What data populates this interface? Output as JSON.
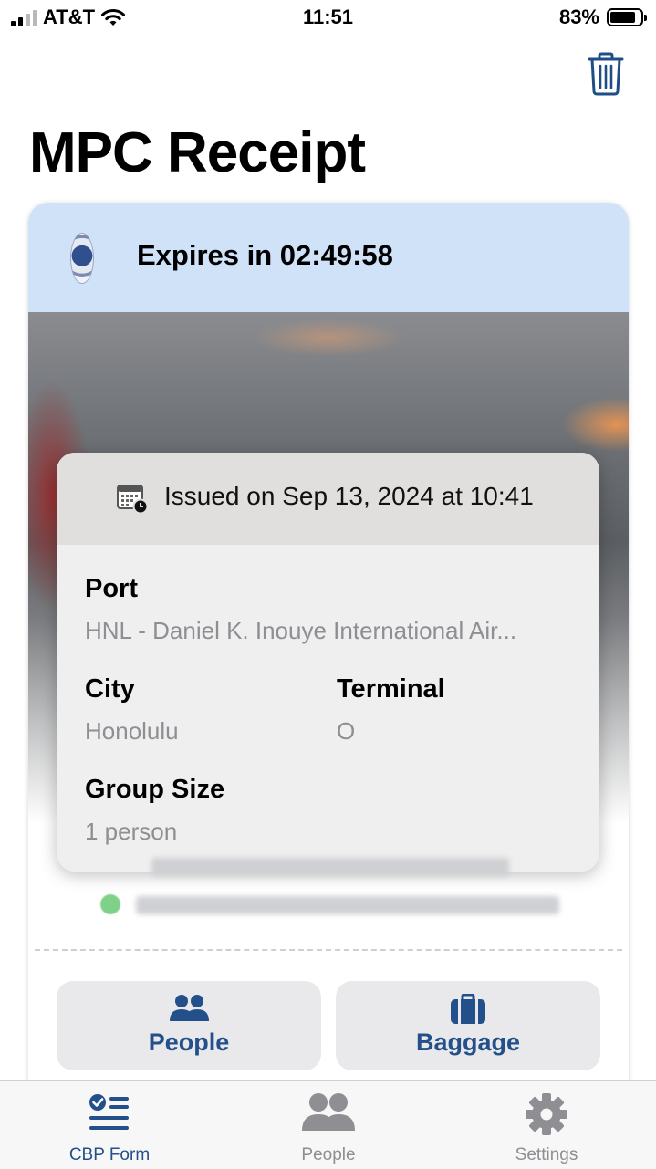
{
  "status_bar": {
    "carrier": "AT&T",
    "time": "11:51",
    "battery": "83%",
    "battery_level": 0.83,
    "icons": [
      "signal-icon",
      "wifi-icon",
      "battery-icon"
    ]
  },
  "header": {
    "title": "MPC Receipt",
    "delete_icon": "trash-icon"
  },
  "receipt": {
    "expires_text": "Expires in 02:49:58",
    "seal_icon": "cbp-seal-icon",
    "issued_text": "Issued on Sep 13, 2024 at 10:41",
    "fields": {
      "port_label": "Port",
      "port_value": "HNL - Daniel K. Inouye International Air...",
      "city_label": "City",
      "city_value": "Honolulu",
      "terminal_label": "Terminal",
      "terminal_value": "O",
      "group_label": "Group Size",
      "group_value": "1 person"
    },
    "actions": [
      {
        "label": "People",
        "icon": "people-icon"
      },
      {
        "label": "Baggage",
        "icon": "baggage-icon"
      }
    ]
  },
  "tabbar": {
    "items": [
      {
        "label": "CBP Form",
        "icon": "form-checklist-icon",
        "active": true
      },
      {
        "label": "People",
        "icon": "people-icon",
        "active": false
      },
      {
        "label": "Settings",
        "icon": "gear-icon",
        "active": false
      }
    ]
  },
  "colors": {
    "accent": "#23508a",
    "header_bg": "#cfe2f8",
    "inactive_tab": "#8e8e93",
    "secondary_text": "#8e8e93"
  }
}
